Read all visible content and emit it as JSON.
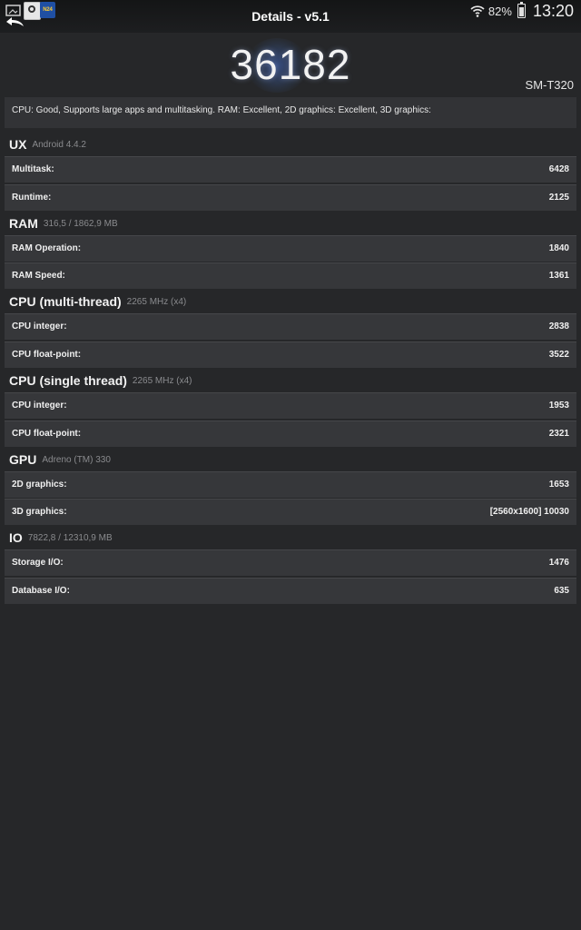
{
  "header": {
    "title": "Details - v5.1",
    "battery": "82%",
    "clock": "13:20",
    "notification_news": "N24"
  },
  "score": {
    "total": "36182",
    "device": "SM-T320",
    "summary": "CPU: Good, Supports large apps and multitasking. RAM: Excellent, 2D graphics: Excellent, 3D graphics:"
  },
  "sections": [
    {
      "name": "UX",
      "sub": "Android 4.4.2",
      "rows": [
        {
          "label": "Multitask:",
          "value": "6428"
        },
        {
          "label": "Runtime:",
          "value": "2125"
        }
      ]
    },
    {
      "name": "RAM",
      "sub": "316,5 / 1862,9 MB",
      "rows": [
        {
          "label": "RAM Operation:",
          "value": "1840"
        },
        {
          "label": "RAM Speed:",
          "value": "1361"
        }
      ]
    },
    {
      "name": "CPU (multi-thread)",
      "sub": "2265 MHz (x4)",
      "rows": [
        {
          "label": "CPU integer:",
          "value": "2838"
        },
        {
          "label": "CPU float-point:",
          "value": "3522"
        }
      ]
    },
    {
      "name": "CPU (single thread)",
      "sub": "2265 MHz (x4)",
      "rows": [
        {
          "label": "CPU integer:",
          "value": "1953"
        },
        {
          "label": "CPU float-point:",
          "value": "2321"
        }
      ]
    },
    {
      "name": "GPU",
      "sub": "Adreno (TM) 330",
      "rows": [
        {
          "label": "2D graphics:",
          "value": "1653"
        },
        {
          "label": "3D graphics:",
          "value": "[2560x1600] 10030"
        }
      ]
    },
    {
      "name": "IO",
      "sub": "7822,8 / 12310,9 MB",
      "rows": [
        {
          "label": "Storage I/O:",
          "value": "1476"
        },
        {
          "label": "Database I/O:",
          "value": "635"
        }
      ]
    }
  ]
}
